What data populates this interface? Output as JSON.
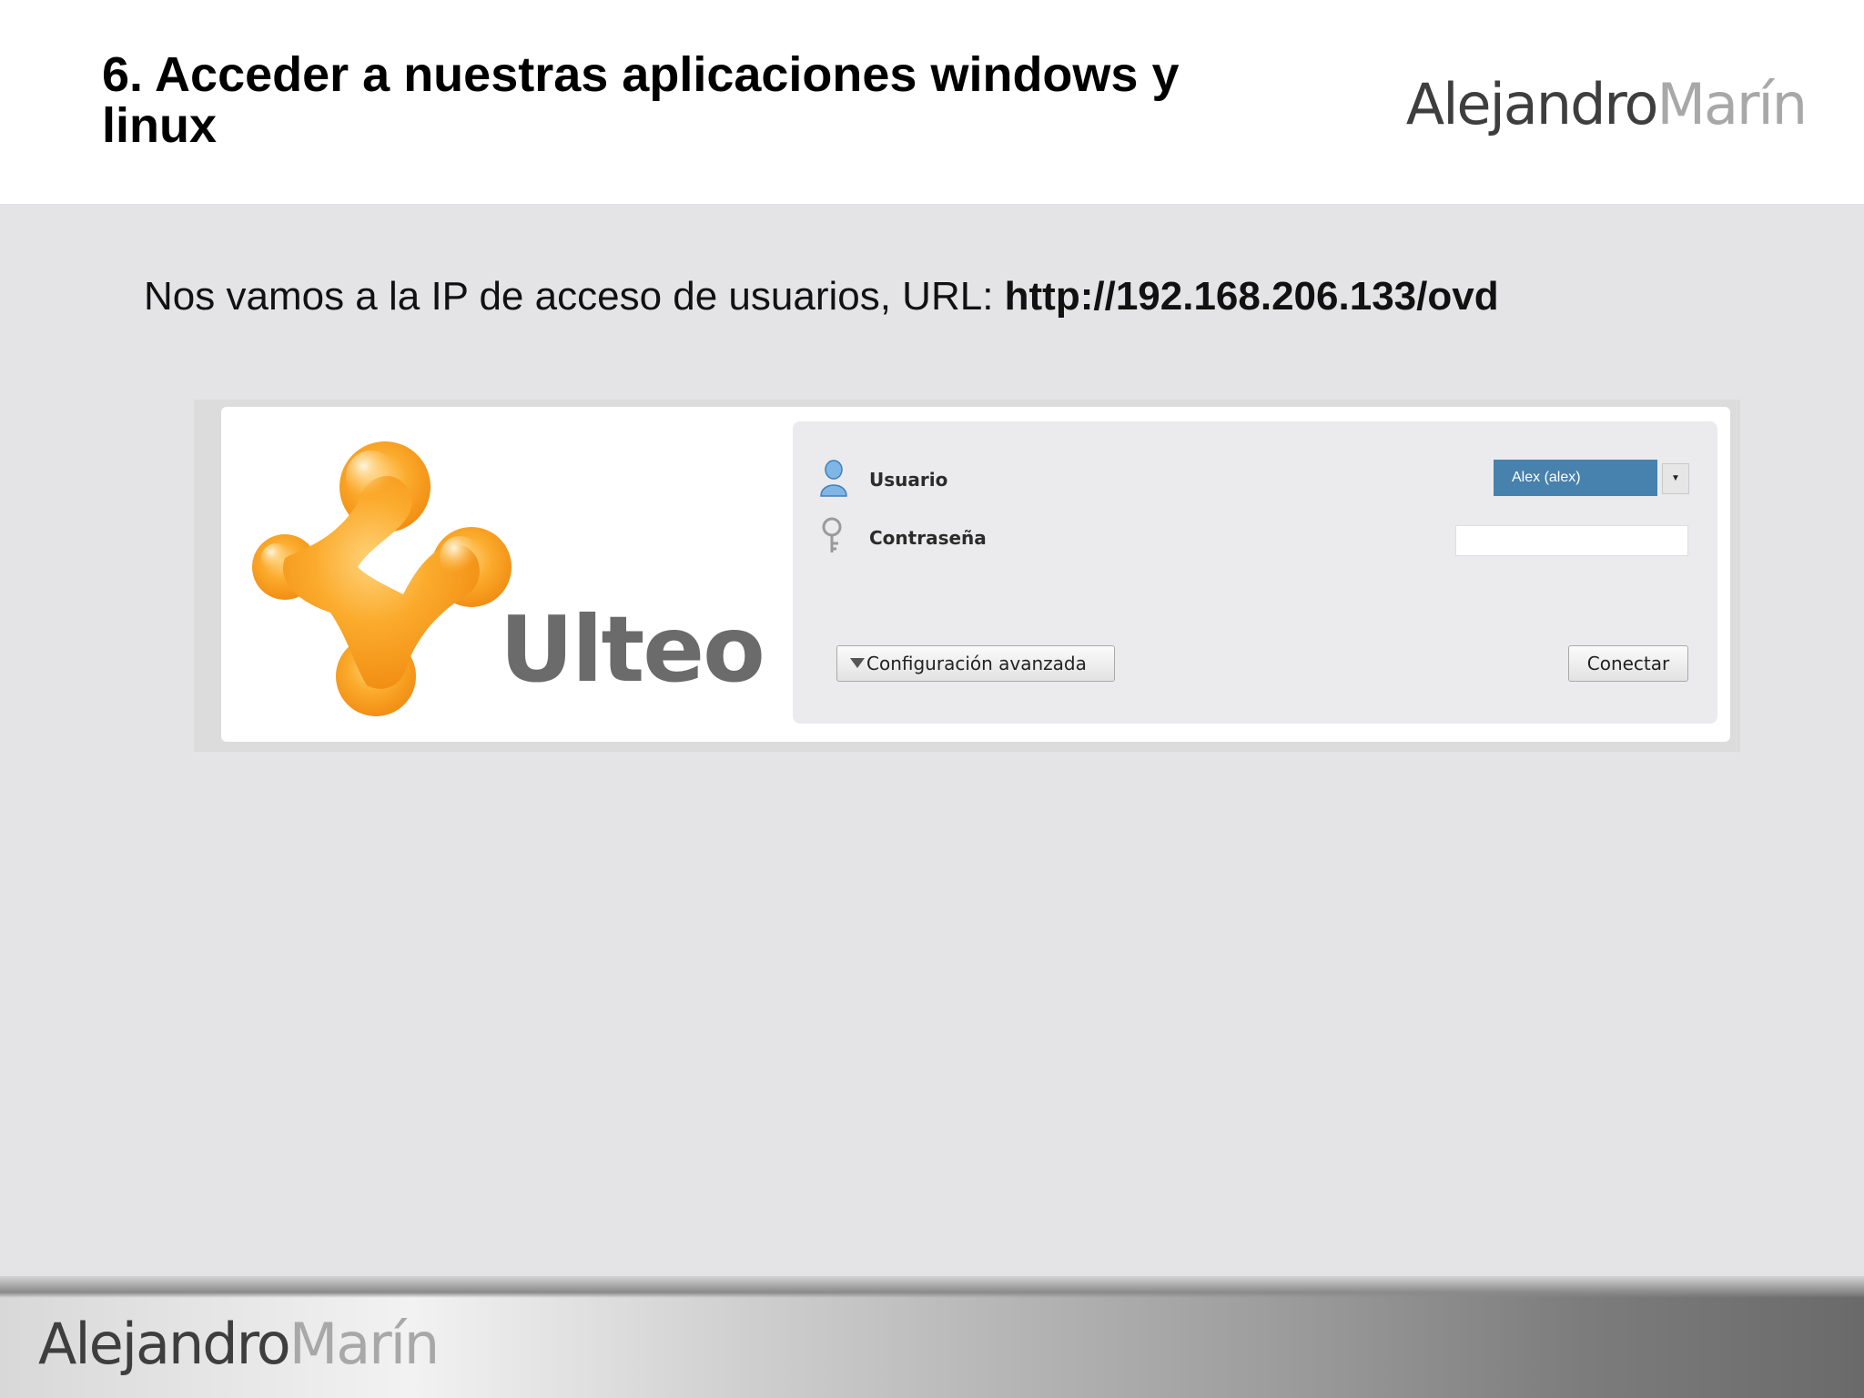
{
  "slide": {
    "title": "6. Acceder a nuestras aplicaciones windows y linux",
    "intro_text": "Nos vamos a la IP de acceso de usuarios, URL: ",
    "intro_url": "http://192.168.206.133/ovd"
  },
  "brand": {
    "first": "Alejandro",
    "last": "Marín"
  },
  "ulteo": {
    "logo_text": "Ulteo",
    "user_label": "Usuario",
    "user_value": "Alex (alex)",
    "password_label": "Contraseña",
    "password_value": "",
    "advanced_button": "Configuración avanzada",
    "connect_button": "Conectar"
  },
  "colors": {
    "logo_orange": "#f7931e",
    "select_blue": "#4781ad",
    "page_background": "#e4e4e6"
  }
}
